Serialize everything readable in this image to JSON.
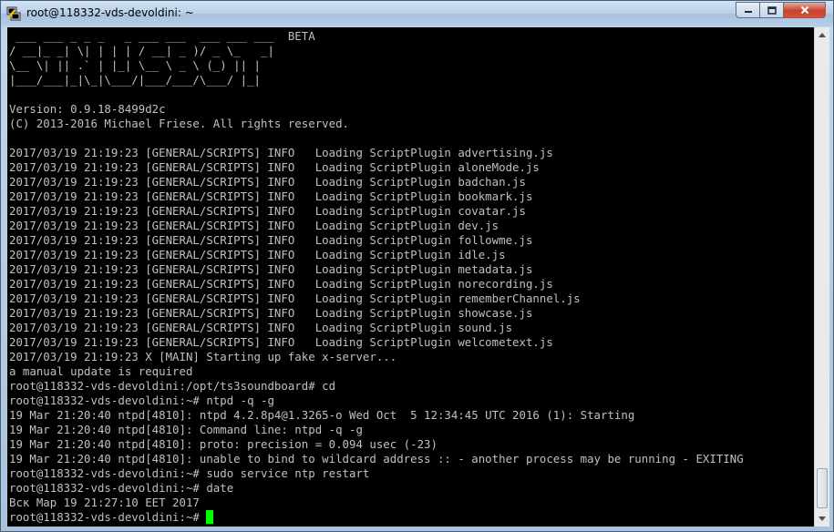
{
  "window": {
    "title": "root@118332-vds-devoldini: ~",
    "app_icon": "putty-icon",
    "controls": {
      "minimize": "minimize-icon",
      "maximize": "maximize-icon",
      "close": "close-icon"
    }
  },
  "terminal": {
    "lines": [
      " ___ ___ _ _ _   _ ___ ___  ___ ___ ___  BETA",
      "/ __|_ _| \\| | | | / __| _ )/ _ \\_   _|",
      "\\__ \\| || .` | |_| \\__ \\ _ \\ (_) || |",
      "|___/___|_|\\_|\\___/|___/___/\\___/ |_|",
      "",
      "Version: 0.9.18-8499d2c",
      "(C) 2013-2016 Michael Friese. All rights reserved.",
      "",
      "2017/03/19 21:19:23 [GENERAL/SCRIPTS] INFO   Loading ScriptPlugin advertising.js",
      "2017/03/19 21:19:23 [GENERAL/SCRIPTS] INFO   Loading ScriptPlugin aloneMode.js",
      "2017/03/19 21:19:23 [GENERAL/SCRIPTS] INFO   Loading ScriptPlugin badchan.js",
      "2017/03/19 21:19:23 [GENERAL/SCRIPTS] INFO   Loading ScriptPlugin bookmark.js",
      "2017/03/19 21:19:23 [GENERAL/SCRIPTS] INFO   Loading ScriptPlugin covatar.js",
      "2017/03/19 21:19:23 [GENERAL/SCRIPTS] INFO   Loading ScriptPlugin dev.js",
      "2017/03/19 21:19:23 [GENERAL/SCRIPTS] INFO   Loading ScriptPlugin followme.js",
      "2017/03/19 21:19:23 [GENERAL/SCRIPTS] INFO   Loading ScriptPlugin idle.js",
      "2017/03/19 21:19:23 [GENERAL/SCRIPTS] INFO   Loading ScriptPlugin metadata.js",
      "2017/03/19 21:19:23 [GENERAL/SCRIPTS] INFO   Loading ScriptPlugin norecording.js",
      "2017/03/19 21:19:23 [GENERAL/SCRIPTS] INFO   Loading ScriptPlugin rememberChannel.js",
      "2017/03/19 21:19:23 [GENERAL/SCRIPTS] INFO   Loading ScriptPlugin showcase.js",
      "2017/03/19 21:19:23 [GENERAL/SCRIPTS] INFO   Loading ScriptPlugin sound.js",
      "2017/03/19 21:19:23 [GENERAL/SCRIPTS] INFO   Loading ScriptPlugin welcometext.js",
      "2017/03/19 21:19:23 X [MAIN] Starting up fake x-server...",
      "a manual update is required",
      "root@118332-vds-devoldini:/opt/ts3soundboard# cd",
      "root@118332-vds-devoldini:~# ntpd -q -g",
      "19 Mar 21:20:40 ntpd[4810]: ntpd 4.2.8p4@1.3265-o Wed Oct  5 12:34:45 UTC 2016 (1): Starting",
      "19 Mar 21:20:40 ntpd[4810]: Command line: ntpd -q -g",
      "19 Mar 21:20:40 ntpd[4810]: proto: precision = 0.094 usec (-23)",
      "19 Mar 21:20:40 ntpd[4810]: unable to bind to wildcard address :: - another process may be running - EXITING",
      "root@118332-vds-devoldini:~# sudo service ntp restart",
      "root@118332-vds-devoldini:~# date",
      "Вск Мар 19 21:27:10 EET 2017"
    ],
    "prompt": "root@118332-vds-devoldini:~# ",
    "cursor_color": "#00ff00",
    "text_color": "#c0c0c0",
    "background": "#000000"
  },
  "scrollbar": {
    "up": "scroll-up-arrow-icon",
    "down": "scroll-down-arrow-icon"
  }
}
